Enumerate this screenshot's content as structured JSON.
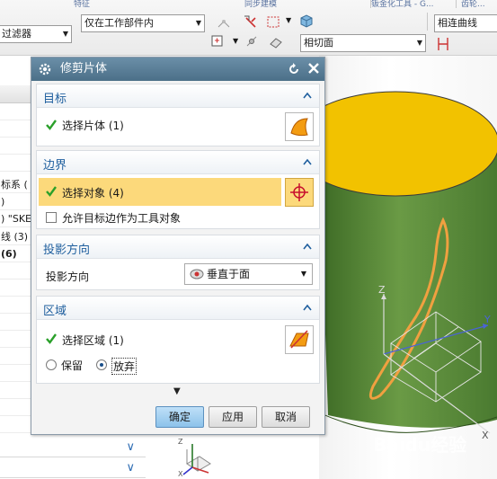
{
  "ribbon": {
    "strip_texts": [
      "特征",
      "同步建模",
      "钣金化工具 - G...",
      "齿轮..."
    ],
    "filter_combo": "过滤器",
    "scope_combo": "仅在工作部件内",
    "curve_rule_combo": "相连曲线",
    "face_rule_combo": "相切面"
  },
  "navigator": {
    "rows": [
      "标系 (",
      ")",
      ") \"SKE",
      "线 (3)",
      "(6)"
    ]
  },
  "dialog": {
    "title": "修剪片体",
    "target": {
      "title": "目标",
      "select_label": "选择片体 (1)"
    },
    "boundary": {
      "title": "边界",
      "select_label": "选择对象 (4)",
      "allow_tool_label": "允许目标边作为工具对象"
    },
    "projection": {
      "title": "投影方向",
      "label": "投影方向",
      "value": "垂直于面"
    },
    "region": {
      "title": "区域",
      "select_label": "选择区域 (1)",
      "keep_label": "保留",
      "discard_label": "放弃",
      "selected": "放弃"
    },
    "buttons": {
      "ok": "确定",
      "apply": "应用",
      "cancel": "取消"
    }
  },
  "viewport": {
    "axis_z": "Z",
    "axis_y": "Y",
    "axis_x": "X",
    "watermark": "Baidu经验",
    "colors": {
      "cone": "#5e8f3e",
      "top_face": "#f2c200",
      "curve": "#f0a040"
    }
  }
}
